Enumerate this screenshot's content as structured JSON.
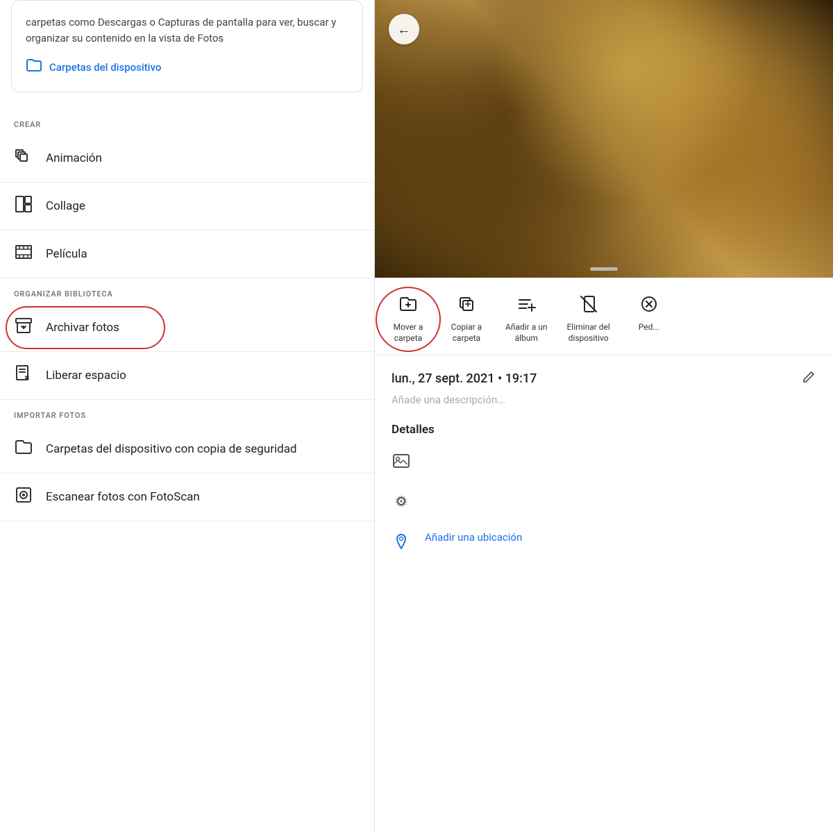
{
  "left": {
    "info_card": {
      "text": "carpetas como Descargas o Capturas de pantalla para ver, buscar y organizar su contenido en la vista de Fotos",
      "link_label": "Carpetas del dispositivo"
    },
    "crear_section": {
      "label": "CREAR",
      "items": [
        {
          "id": "animacion",
          "icon": "copy",
          "label": "Animación"
        },
        {
          "id": "collage",
          "icon": "collage",
          "label": "Collage"
        },
        {
          "id": "pelicula",
          "icon": "movie",
          "label": "Película"
        }
      ]
    },
    "organizar_section": {
      "label": "ORGANIZAR BIBLIOTECA",
      "items": [
        {
          "id": "archivar",
          "icon": "archive",
          "label": "Archivar fotos",
          "highlighted": true
        },
        {
          "id": "liberar",
          "icon": "free",
          "label": "Liberar espacio"
        }
      ]
    },
    "importar_section": {
      "label": "IMPORTAR FOTOS",
      "items": [
        {
          "id": "carpetas-dispositivo",
          "icon": "folder",
          "label": "Carpetas del dispositivo con copia de seguridad"
        },
        {
          "id": "fotoscan",
          "icon": "scan",
          "label": "Escanear fotos con FotoScan"
        }
      ]
    }
  },
  "right": {
    "back_button": "←",
    "action_bar": {
      "items": [
        {
          "id": "mover-carpeta",
          "icon": "folder-add",
          "label": "Mover a\ncarpeta",
          "highlighted": true
        },
        {
          "id": "copiar-carpeta",
          "icon": "copy-album",
          "label": "Copiar a\ncarpeta"
        },
        {
          "id": "anadir-album",
          "icon": "add-list",
          "label": "Añadir a un\nálbum"
        },
        {
          "id": "eliminar-dispositivo",
          "icon": "no-phone",
          "label": "Eliminar del\ndispositivo"
        },
        {
          "id": "ped",
          "icon": "ped",
          "label": "Ped..."
        }
      ]
    },
    "photo_info": {
      "date": "lun., 27 sept. 2021 • 19:17",
      "description_placeholder": "Añade una descripción...",
      "details_title": "Detalles",
      "location_label": "Añadir una ubicación"
    }
  }
}
